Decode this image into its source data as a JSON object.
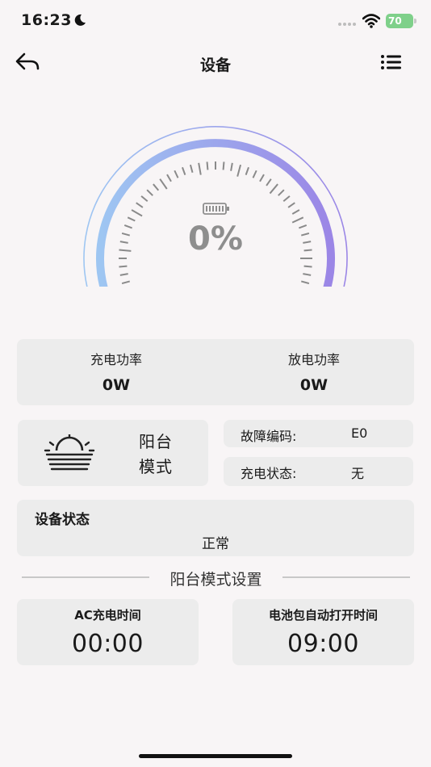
{
  "status_bar": {
    "time": "16:23",
    "battery": "70"
  },
  "nav": {
    "title": "设备"
  },
  "gauge": {
    "value_text": "0%",
    "level": 0
  },
  "power": {
    "charge_label": "充电功率",
    "charge_value": "0W",
    "discharge_label": "放电功率",
    "discharge_value": "0W"
  },
  "mode": {
    "label_line1": "阳台",
    "label_line2": "模式"
  },
  "fault": {
    "label": "故障编码:",
    "value": "E0"
  },
  "charge_state": {
    "label": "充电状态:",
    "value": "无"
  },
  "device_status": {
    "title": "设备状态",
    "value": "正常"
  },
  "section": {
    "title": "阳台模式设置"
  },
  "ac_charge": {
    "label": "AC充电时间",
    "value": "00:00"
  },
  "pack_open": {
    "label": "电池包自动打开时间",
    "value": "09:00"
  },
  "colors": {
    "gauge_start": "#9ec6f2",
    "gauge_end": "#9b86e6",
    "card_bg": "#ececec"
  }
}
